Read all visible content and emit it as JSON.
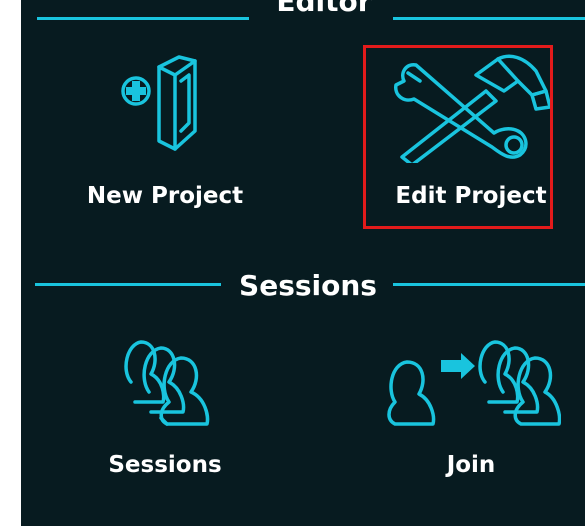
{
  "editor_section": {
    "title": "Editor",
    "tiles": [
      {
        "label": "New Project",
        "icon": "new-project-icon",
        "selected": false
      },
      {
        "label": "Edit Project",
        "icon": "edit-project-icon",
        "selected": true
      }
    ]
  },
  "sessions_section": {
    "title": "Sessions",
    "tiles": [
      {
        "label": "Sessions",
        "icon": "sessions-icon",
        "selected": false
      },
      {
        "label": "Join",
        "icon": "join-icon",
        "selected": false
      }
    ]
  },
  "colors": {
    "background": "#071b20",
    "accent": "#19c4de",
    "selection": "#e31b1b",
    "text": "#ffffff"
  }
}
